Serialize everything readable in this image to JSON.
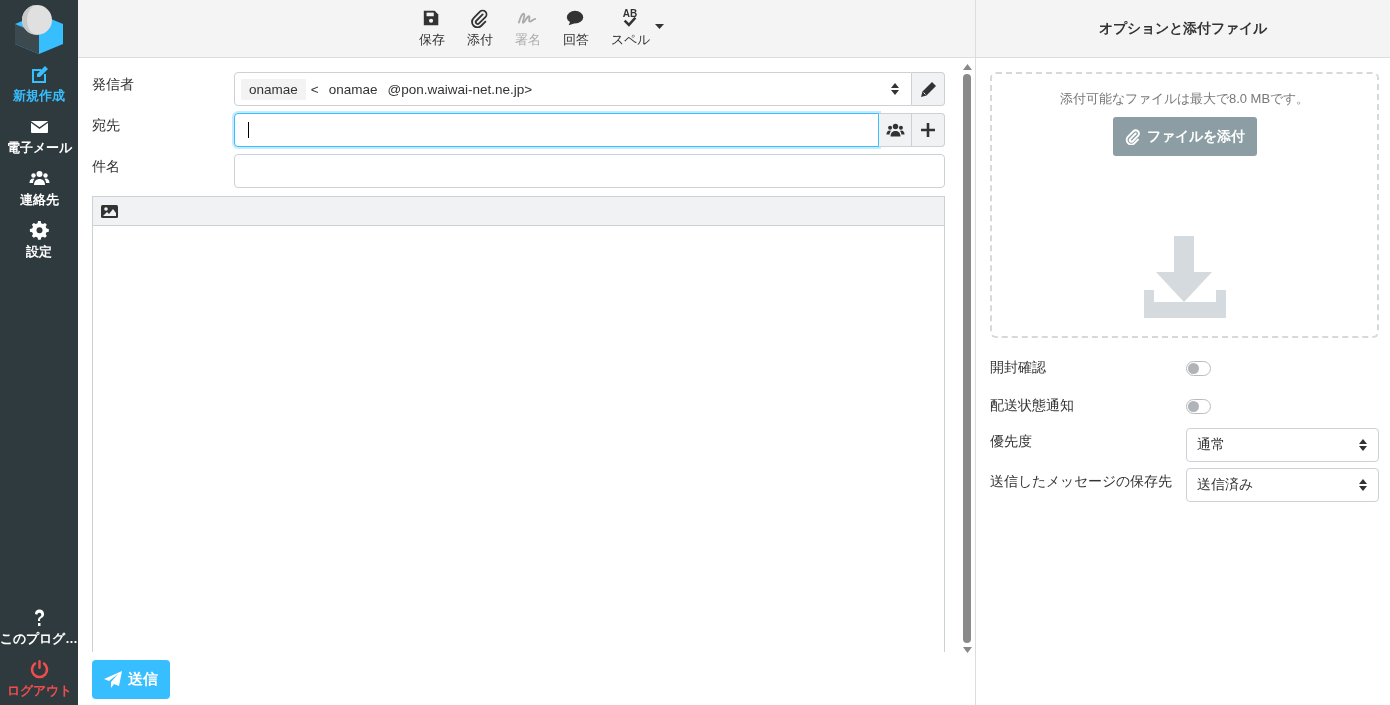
{
  "sidebar": {
    "items": [
      {
        "kind": "compose",
        "label": "新規作成",
        "selected": true
      },
      {
        "kind": "mail",
        "label": "電子メール",
        "selected": false
      },
      {
        "kind": "contacts",
        "label": "連絡先",
        "selected": false
      },
      {
        "kind": "settings",
        "label": "設定",
        "selected": false
      }
    ],
    "footer": [
      {
        "kind": "about",
        "label": "このプログ…"
      },
      {
        "kind": "logout",
        "label": "ログアウト"
      }
    ]
  },
  "toolbar": [
    {
      "kind": "save",
      "label": "保存",
      "disabled": false,
      "dropdown": false
    },
    {
      "kind": "attach",
      "label": "添付",
      "disabled": false,
      "dropdown": false
    },
    {
      "kind": "signature",
      "label": "署名",
      "disabled": true,
      "dropdown": false
    },
    {
      "kind": "reply",
      "label": "回答",
      "disabled": false,
      "dropdown": false
    },
    {
      "kind": "spell",
      "label": "スペル",
      "glyph": "AB",
      "disabled": false,
      "dropdown": true
    }
  ],
  "compose": {
    "from": {
      "label": "発信者",
      "name": "onamae",
      "open": "<",
      "user": "onamae",
      "domain": "@pon.waiwai-net.ne.jp>"
    },
    "to": {
      "label": "宛先",
      "focused": true
    },
    "subject": {
      "label": "件名",
      "focused": false
    },
    "send": "送信"
  },
  "options": {
    "title": "オプションと添付ファイル",
    "dropzone": {
      "hint": "添付可能なファイルは最大で8.0 MBです。",
      "button": "ファイルを添付"
    },
    "rows": [
      {
        "kind": "toggle",
        "label": "開封確認",
        "on": false
      },
      {
        "kind": "toggle",
        "label": "配送状態通知",
        "on": false
      },
      {
        "kind": "select",
        "label": "優先度",
        "value": "通常"
      },
      {
        "kind": "select",
        "label": "送信したメッセージの保存先",
        "value": "送信済み"
      }
    ]
  }
}
